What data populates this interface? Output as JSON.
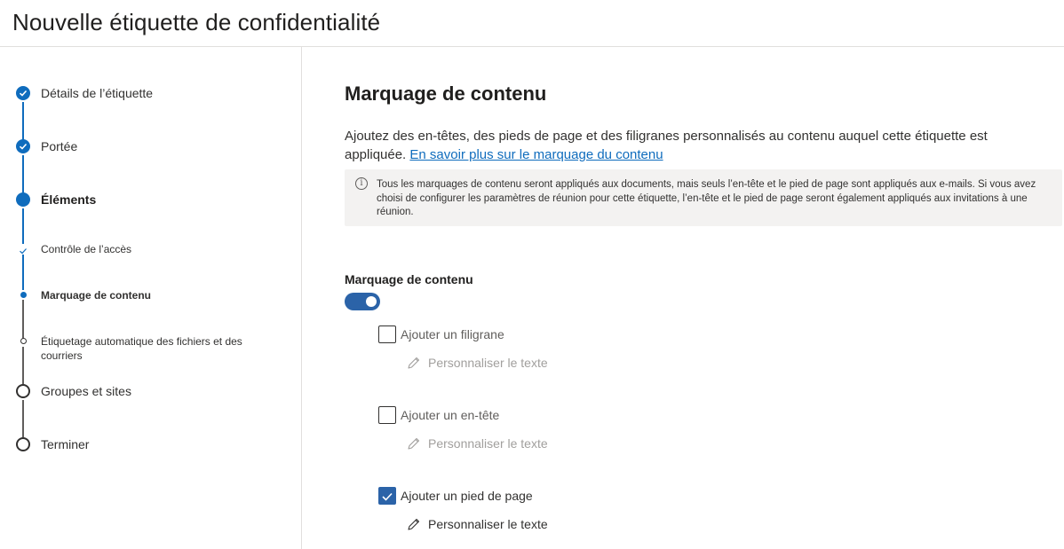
{
  "header": {
    "title": "Nouvelle étiquette de confidentialité"
  },
  "sidebar": {
    "steps": [
      {
        "label": "Détails de l’étiquette",
        "state": "done"
      },
      {
        "label": "Portée",
        "state": "done"
      },
      {
        "label": "Éléments",
        "state": "current"
      },
      {
        "label": "Groupes et sites",
        "state": "todo"
      },
      {
        "label": "Terminer",
        "state": "todo"
      }
    ],
    "substeps": [
      {
        "label": "Contrôle de l’accès",
        "state": "done"
      },
      {
        "label": "Marquage de contenu",
        "state": "current"
      },
      {
        "label": "Étiquetage automatique des fichiers et des courriers",
        "state": "todo"
      }
    ]
  },
  "main": {
    "title": "Marquage de contenu",
    "description": "Ajoutez des en-têtes, des pieds de page et des filigranes personnalisés au contenu auquel cette étiquette est appliquée.",
    "learn_more_link": "En savoir plus sur le marquage du contenu",
    "info_text": "Tous les marquages de contenu seront appliqués aux documents, mais seuls l’en-tête et le pied de page sont appliqués aux e-mails. Si vous avez choisi de configurer les paramètres de réunion pour cette étiquette, l’en-tête et le pied de page seront également appliqués aux invitations à une réunion.",
    "toggle": {
      "label": "Marquage de contenu",
      "on": true
    },
    "options": [
      {
        "label": "Ajouter un filigrane",
        "checked": false,
        "edit_label": "Personnaliser le texte"
      },
      {
        "label": "Ajouter un en-tête",
        "checked": false,
        "edit_label": "Personnaliser le texte"
      },
      {
        "label": "Ajouter un pied de page",
        "checked": true,
        "edit_label": "Personnaliser le texte"
      }
    ]
  },
  "colors": {
    "accent": "#0f6cbd",
    "toggle_on": "#2b63a8",
    "info_bg": "#f3f2f1"
  }
}
